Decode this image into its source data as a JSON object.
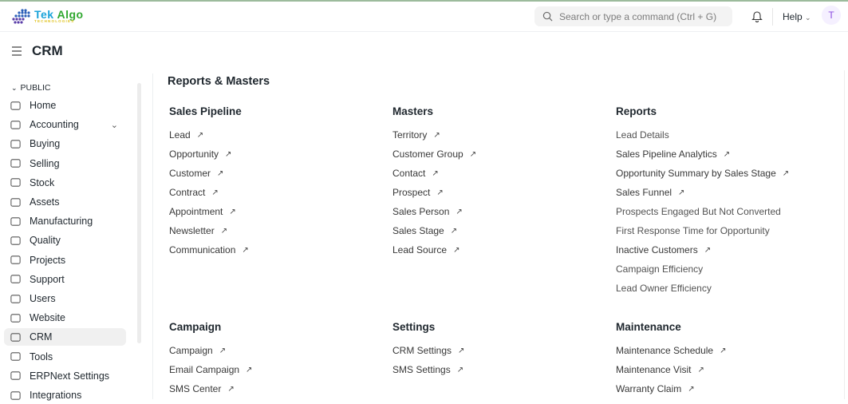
{
  "navbar": {
    "logo_main_a": "Tek",
    "logo_main_b": "Algo",
    "logo_sub": "TECHNOLOGIES",
    "search_placeholder": "Search or type a command (Ctrl + G)",
    "help_label": "Help",
    "avatar_initial": "T"
  },
  "page": {
    "title": "CRM"
  },
  "sidebar": {
    "section": "PUBLIC",
    "items": [
      {
        "label": "Home",
        "icon": "tools-icon"
      },
      {
        "label": "Accounting",
        "icon": "money-icon"
      },
      {
        "label": "Buying",
        "icon": "basket-icon"
      },
      {
        "label": "Selling",
        "icon": "card-icon"
      },
      {
        "label": "Stock",
        "icon": "box-icon"
      },
      {
        "label": "Assets",
        "icon": "assets-icon"
      },
      {
        "label": "Manufacturing",
        "icon": "building-icon"
      },
      {
        "label": "Quality",
        "icon": "shield-icon"
      },
      {
        "label": "Projects",
        "icon": "folder-icon"
      },
      {
        "label": "Support",
        "icon": "headset-icon"
      },
      {
        "label": "Users",
        "icon": "users-icon"
      },
      {
        "label": "Website",
        "icon": "browser-icon"
      },
      {
        "label": "CRM",
        "icon": "pie-chart-icon"
      },
      {
        "label": "Tools",
        "icon": "tools-icon"
      },
      {
        "label": "ERPNext Settings",
        "icon": "settings-icon"
      },
      {
        "label": "Integrations",
        "icon": "integrations-icon"
      }
    ]
  },
  "main": {
    "section_title": "Reports & Masters",
    "cards": [
      {
        "title": "Sales Pipeline",
        "links": [
          {
            "label": "Lead",
            "arrow": true
          },
          {
            "label": "Opportunity",
            "arrow": true
          },
          {
            "label": "Customer",
            "arrow": true
          },
          {
            "label": "Contract",
            "arrow": true
          },
          {
            "label": "Appointment",
            "arrow": true
          },
          {
            "label": "Newsletter",
            "arrow": true
          },
          {
            "label": "Communication",
            "arrow": true
          }
        ]
      },
      {
        "title": "Masters",
        "links": [
          {
            "label": "Territory",
            "arrow": true
          },
          {
            "label": "Customer Group",
            "arrow": true
          },
          {
            "label": "Contact",
            "arrow": true
          },
          {
            "label": "Prospect",
            "arrow": true
          },
          {
            "label": "Sales Person",
            "arrow": true
          },
          {
            "label": "Sales Stage",
            "arrow": true
          },
          {
            "label": "Lead Source",
            "arrow": true
          }
        ]
      },
      {
        "title": "Reports",
        "links": [
          {
            "label": "Lead Details",
            "arrow": false
          },
          {
            "label": "Sales Pipeline Analytics",
            "arrow": true
          },
          {
            "label": "Opportunity Summary by Sales Stage",
            "arrow": true
          },
          {
            "label": "Sales Funnel",
            "arrow": true
          },
          {
            "label": "Prospects Engaged But Not Converted",
            "arrow": false
          },
          {
            "label": "First Response Time for Opportunity",
            "arrow": false
          },
          {
            "label": "Inactive Customers",
            "arrow": true
          },
          {
            "label": "Campaign Efficiency",
            "arrow": false
          },
          {
            "label": "Lead Owner Efficiency",
            "arrow": false
          }
        ]
      },
      {
        "title": "Campaign",
        "links": [
          {
            "label": "Campaign",
            "arrow": true
          },
          {
            "label": "Email Campaign",
            "arrow": true
          },
          {
            "label": "SMS Center",
            "arrow": true
          }
        ]
      },
      {
        "title": "Settings",
        "links": [
          {
            "label": "CRM Settings",
            "arrow": true
          },
          {
            "label": "SMS Settings",
            "arrow": true
          }
        ]
      },
      {
        "title": "Maintenance",
        "links": [
          {
            "label": "Maintenance Schedule",
            "arrow": true
          },
          {
            "label": "Maintenance Visit",
            "arrow": true
          },
          {
            "label": "Warranty Claim",
            "arrow": true
          }
        ]
      }
    ]
  }
}
